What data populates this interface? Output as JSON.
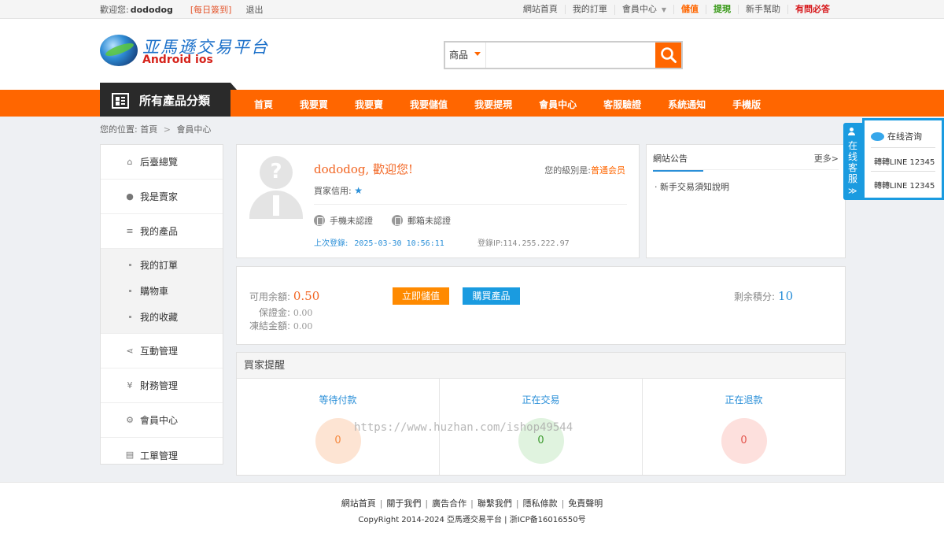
{
  "topbar": {
    "welcome_prefix": "歡迎您:",
    "username": "dododog",
    "checkin": "[每日簽到]",
    "logout": "退出",
    "links": [
      "網站首頁",
      "我的訂單",
      "會員中心",
      "儲值",
      "提現",
      "新手幫助",
      "有問必答"
    ]
  },
  "logo": {
    "cn": "亚馬遜交易平台",
    "en": "Android ios"
  },
  "search": {
    "category": "商品",
    "placeholder": ""
  },
  "nav": {
    "all_categories": "所有產品分類",
    "items": [
      "首頁",
      "我要買",
      "我要賣",
      "我要儲值",
      "我要提現",
      "會員中心",
      "客服驗證",
      "系統通知",
      "手機版"
    ]
  },
  "breadcrumb": {
    "label": "您的位置:",
    "home": "首頁",
    "current": "會員中心"
  },
  "sidebar": {
    "items": [
      "后臺總覽",
      "我是賣家",
      "我的產品"
    ],
    "sub": [
      "我的訂單",
      "購物車",
      "我的收藏"
    ],
    "items2": [
      "互動管理",
      "財務管理",
      "會員中心",
      "工單管理"
    ]
  },
  "profile": {
    "welcome": "dododog, 歡迎您!",
    "level_label": "您的級別是:",
    "level_value": "普通会员",
    "credit_label": "買家信用:",
    "credit_star": "★",
    "phone": "手機未認證",
    "email": "郵箱未認證",
    "last_login_label": "上次登錄:",
    "last_login_time": "2025-03-30 10:56:11",
    "ip_label": "登錄IP:",
    "ip_value": "114.255.222.97"
  },
  "notice": {
    "title": "網站公告",
    "more": "更多>",
    "items": [
      "· 新手交易須知說明"
    ]
  },
  "balance": {
    "available_label": "可用余額:",
    "available_value": "0.50",
    "deposit_label": "保證金:",
    "deposit_value": "0.00",
    "frozen_label": "凍結金額:",
    "frozen_value": "0.00",
    "recharge_button": "立即儲值",
    "buy_button": "購買產品",
    "points_label": "剩余積分:",
    "points_value": "10"
  },
  "reminder": {
    "title": "買家提醒",
    "cols": [
      {
        "label": "等待付款",
        "count": "0"
      },
      {
        "label": "正在交易",
        "count": "0"
      },
      {
        "label": "正在退款",
        "count": "0"
      }
    ]
  },
  "watermark": "https://www.huzhan.com/ishop49544",
  "footer": {
    "links": [
      "網站首頁",
      "關于我們",
      "廣告合作",
      "聯繫我們",
      "隱私條款",
      "免責聲明"
    ],
    "copyright": "CopyRight 2014-2024 亞馬遜交易平台 | 浙ICP备16016550号"
  },
  "service": {
    "tab_text": "在线客服",
    "tab_arrow": "≫",
    "header": "在线咨询",
    "contacts": [
      "轉轉LINE 12345",
      "轉轉LINE 12345"
    ]
  },
  "colors": {
    "accent": "#ff6600",
    "dark": "#2a2a2a",
    "blue": "#1a9be0"
  }
}
